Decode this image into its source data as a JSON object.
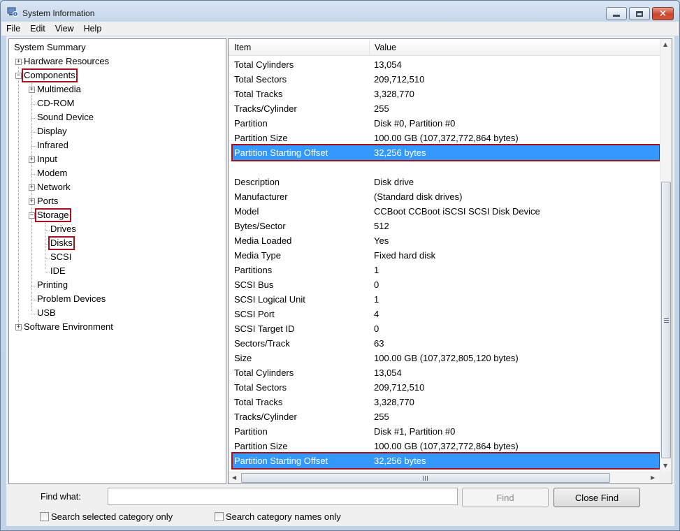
{
  "window": {
    "title": "System Information",
    "icon": "system-information-icon"
  },
  "menu": [
    "File",
    "Edit",
    "View",
    "Help"
  ],
  "tree": [
    {
      "label": "System Summary",
      "level": 0,
      "expander": ""
    },
    {
      "label": "Hardware Resources",
      "level": 0,
      "expander": "+"
    },
    {
      "label": "Components",
      "level": 0,
      "expander": "-",
      "boxed": true
    },
    {
      "label": "Multimedia",
      "level": 1,
      "expander": "+"
    },
    {
      "label": "CD-ROM",
      "level": 1,
      "expander": ""
    },
    {
      "label": "Sound Device",
      "level": 1,
      "expander": ""
    },
    {
      "label": "Display",
      "level": 1,
      "expander": ""
    },
    {
      "label": "Infrared",
      "level": 1,
      "expander": ""
    },
    {
      "label": "Input",
      "level": 1,
      "expander": "+"
    },
    {
      "label": "Modem",
      "level": 1,
      "expander": ""
    },
    {
      "label": "Network",
      "level": 1,
      "expander": "+"
    },
    {
      "label": "Ports",
      "level": 1,
      "expander": "+"
    },
    {
      "label": "Storage",
      "level": 1,
      "expander": "-",
      "boxed": true
    },
    {
      "label": "Drives",
      "level": 2,
      "expander": ""
    },
    {
      "label": "Disks",
      "level": 2,
      "expander": "",
      "boxed": true
    },
    {
      "label": "SCSI",
      "level": 2,
      "expander": ""
    },
    {
      "label": "IDE",
      "level": 2,
      "expander": ""
    },
    {
      "label": "Printing",
      "level": 1,
      "expander": ""
    },
    {
      "label": "Problem Devices",
      "level": 1,
      "expander": ""
    },
    {
      "label": "USB",
      "level": 1,
      "expander": ""
    },
    {
      "label": "Software Environment",
      "level": 0,
      "expander": "+"
    }
  ],
  "list": {
    "columns": [
      "Item",
      "Value"
    ],
    "rows": [
      {
        "item": "Total Cylinders",
        "value": "13,054"
      },
      {
        "item": "Total Sectors",
        "value": "209,712,510"
      },
      {
        "item": "Total Tracks",
        "value": "3,328,770"
      },
      {
        "item": "Tracks/Cylinder",
        "value": "255"
      },
      {
        "item": "Partition",
        "value": "Disk #0, Partition #0"
      },
      {
        "item": "Partition Size",
        "value": "100.00 GB (107,372,772,864 bytes)"
      },
      {
        "item": "Partition Starting Offset",
        "value": "32,256 bytes",
        "selected": true
      },
      {
        "item": "",
        "value": ""
      },
      {
        "item": "Description",
        "value": "Disk drive"
      },
      {
        "item": "Manufacturer",
        "value": "(Standard disk drives)"
      },
      {
        "item": "Model",
        "value": "CCBoot CCBoot iSCSI SCSI Disk Device"
      },
      {
        "item": "Bytes/Sector",
        "value": "512"
      },
      {
        "item": "Media Loaded",
        "value": "Yes"
      },
      {
        "item": "Media Type",
        "value": "Fixed hard disk"
      },
      {
        "item": "Partitions",
        "value": "1"
      },
      {
        "item": "SCSI Bus",
        "value": "0"
      },
      {
        "item": "SCSI Logical Unit",
        "value": "1"
      },
      {
        "item": "SCSI Port",
        "value": "4"
      },
      {
        "item": "SCSI Target ID",
        "value": "0"
      },
      {
        "item": "Sectors/Track",
        "value": "63"
      },
      {
        "item": "Size",
        "value": "100.00 GB (107,372,805,120 bytes)"
      },
      {
        "item": "Total Cylinders",
        "value": "13,054"
      },
      {
        "item": "Total Sectors",
        "value": "209,712,510"
      },
      {
        "item": "Total Tracks",
        "value": "3,328,770"
      },
      {
        "item": "Tracks/Cylinder",
        "value": "255"
      },
      {
        "item": "Partition",
        "value": "Disk #1, Partition #0"
      },
      {
        "item": "Partition Size",
        "value": "100.00 GB (107,372,772,864 bytes)"
      },
      {
        "item": "Partition Starting Offset",
        "value": "32,256 bytes",
        "selected": true
      }
    ]
  },
  "find": {
    "label": "Find what:",
    "value": "",
    "find_button": "Find",
    "close_button": "Close Find",
    "check_selected": "Search selected category only",
    "check_names": "Search category names only"
  },
  "colors": {
    "selection": "#3399ff",
    "highlight_box": "#a8101c"
  }
}
